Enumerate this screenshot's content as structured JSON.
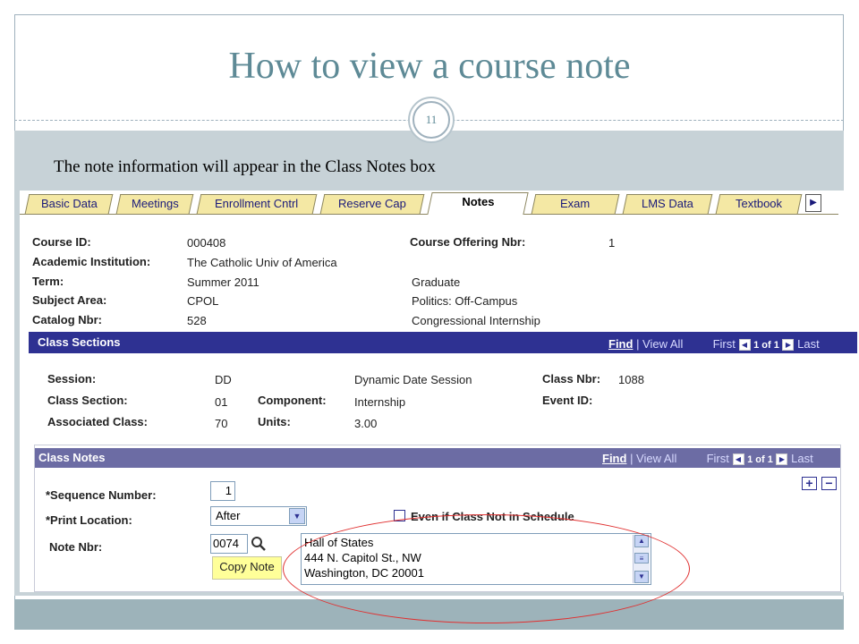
{
  "slide": {
    "title": "How to view a course note",
    "slide_number": "11",
    "subtitle": "The note information will appear in the Class Notes box"
  },
  "tabs": [
    {
      "label": "Basic Data"
    },
    {
      "label": "Meetings"
    },
    {
      "label": "Enrollment Cntrl"
    },
    {
      "label": "Reserve Cap"
    },
    {
      "label": "Notes",
      "active": true
    },
    {
      "label": "Exam"
    },
    {
      "label": "LMS Data"
    },
    {
      "label": "Textbook"
    }
  ],
  "header": {
    "course_id_label": "Course ID:",
    "course_id": "000408",
    "offering_label": "Course Offering Nbr:",
    "offering": "1",
    "institution_label": "Academic Institution:",
    "institution": "The Catholic Univ of America",
    "term_label": "Term:",
    "term": "Summer 2011",
    "career": "Graduate",
    "subject_label": "Subject Area:",
    "subject": "CPOL",
    "subject_desc": "Politics: Off-Campus",
    "catalog_label": "Catalog Nbr:",
    "catalog": "528",
    "catalog_desc": "Congressional Internship"
  },
  "class_sections": {
    "title": "Class Sections",
    "find": "Find",
    "view_all": "| View All",
    "first": "First",
    "count": "1 of 1",
    "last": "Last",
    "session_label": "Session:",
    "session": "DD",
    "session_desc": "Dynamic Date Session",
    "class_nbr_label": "Class Nbr:",
    "class_nbr": "1088",
    "section_label": "Class Section:",
    "section": "01",
    "component_label": "Component:",
    "component": "Internship",
    "event_label": "Event ID:",
    "assoc_label": "Associated Class:",
    "assoc": "70",
    "units_label": "Units:",
    "units": "3.00"
  },
  "class_notes": {
    "title": "Class Notes",
    "find": "Find",
    "view_all": "| View All",
    "first": "First",
    "count": "1 of 1",
    "last": "Last",
    "seq_label": "*Sequence Number:",
    "seq": "1",
    "print_label": "*Print Location:",
    "print_value": "After",
    "checkbox_label": "Even if Class Not in Schedule",
    "note_nbr_label": "Note Nbr:",
    "note_nbr": "0074",
    "copy_note": "Copy Note",
    "note_lines": [
      "Hall of States",
      "444 N. Capitol St., NW",
      "Washington, DC 20001"
    ],
    "plus": "+",
    "minus": "−"
  },
  "colors": {
    "title": "#5e8a96",
    "bar_blue": "#2e3192",
    "notes_bar": "#6c6ca4",
    "tab_yellow": "#f4e8a4",
    "ellipse": "#e03030"
  }
}
